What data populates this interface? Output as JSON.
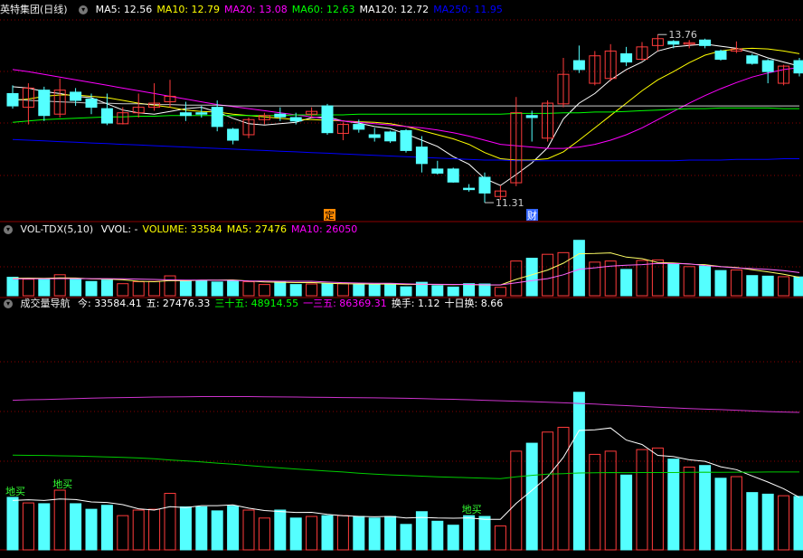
{
  "colors": {
    "up": "#ff3b3b",
    "down": "#54ffff",
    "bg": "#000000",
    "grid": "#8b0000",
    "ma5": "#ffffff",
    "ma10": "#ffff00",
    "ma20": "#ff00ff",
    "ma60": "#00ff00",
    "ma120": "#ffffff",
    "ma250": "#0000ff",
    "vol_ma5": "#ffff66",
    "vol_ma10": "#ff66ff",
    "nav_today": "#ffffff",
    "nav_30": "#00cc00",
    "nav_135": "#cc33cc",
    "marker_ding": "#ff8800",
    "marker_cai": "#3366ff",
    "low_buy": "#33ff33"
  },
  "panel1": {
    "title": "英特集团(日线)",
    "legend": [
      {
        "label": "MA5: 12.56",
        "color": "#ffffff"
      },
      {
        "label": "MA10: 12.79",
        "color": "#ffff00"
      },
      {
        "label": "MA20: 13.08",
        "color": "#ff00ff"
      },
      {
        "label": "MA60: 12.63",
        "color": "#00ff00"
      },
      {
        "label": "MA120: 12.72",
        "color": "#ffffff"
      },
      {
        "label": "MA250: 11.95",
        "color": "#0000ff"
      }
    ],
    "high_label": "13.76",
    "low_label": "11.31",
    "marker_ding": "定",
    "marker_cai": "财"
  },
  "panel2": {
    "title": "VOL-TDX(5,10)",
    "legend": [
      {
        "label": "VVOL: -",
        "color": "#ffffff"
      },
      {
        "label": "VOLUME: 33584",
        "color": "#ffff00"
      },
      {
        "label": "MA5: 27476",
        "color": "#ffff00"
      },
      {
        "label": "MA10: 26050",
        "color": "#ff00ff"
      }
    ]
  },
  "panel3": {
    "title": "成交量导航",
    "legend": [
      {
        "label": "今: 33584.41",
        "color": "#ffffff"
      },
      {
        "label": "五: 27476.33",
        "color": "#ffffff"
      },
      {
        "label": "三十五: 48914.55",
        "color": "#00ff00"
      },
      {
        "label": "一三五: 86369.31",
        "color": "#ff00ff"
      },
      {
        "label": "换手: 1.12",
        "color": "#ffffff"
      },
      {
        "label": "十日换: 8.66",
        "color": "#ffffff"
      }
    ],
    "low_buy_label": "地买"
  },
  "chart_data": {
    "type": "candlestick",
    "title": "英特集团(日线)",
    "candles": [
      {
        "o": 12.9,
        "h": 13.02,
        "l": 12.68,
        "c": 12.72
      },
      {
        "o": 12.7,
        "h": 13.05,
        "l": 12.45,
        "c": 12.98
      },
      {
        "o": 12.95,
        "h": 13.0,
        "l": 12.5,
        "c": 12.58
      },
      {
        "o": 12.6,
        "h": 13.12,
        "l": 12.55,
        "c": 12.95
      },
      {
        "o": 12.92,
        "h": 12.98,
        "l": 12.72,
        "c": 12.8
      },
      {
        "o": 12.82,
        "h": 12.9,
        "l": 12.6,
        "c": 12.7
      },
      {
        "o": 12.68,
        "h": 12.9,
        "l": 12.44,
        "c": 12.47
      },
      {
        "o": 12.46,
        "h": 12.7,
        "l": 12.45,
        "c": 12.62
      },
      {
        "o": 12.62,
        "h": 12.9,
        "l": 12.55,
        "c": 12.7
      },
      {
        "o": 12.7,
        "h": 13.05,
        "l": 12.65,
        "c": 12.76
      },
      {
        "o": 12.78,
        "h": 13.1,
        "l": 12.7,
        "c": 12.86
      },
      {
        "o": 12.62,
        "h": 12.78,
        "l": 12.5,
        "c": 12.58
      },
      {
        "o": 12.62,
        "h": 12.72,
        "l": 12.55,
        "c": 12.6
      },
      {
        "o": 12.7,
        "h": 12.8,
        "l": 12.35,
        "c": 12.42
      },
      {
        "o": 12.38,
        "h": 12.4,
        "l": 12.16,
        "c": 12.22
      },
      {
        "o": 12.3,
        "h": 12.55,
        "l": 12.25,
        "c": 12.52
      },
      {
        "o": 12.52,
        "h": 12.62,
        "l": 12.45,
        "c": 12.58
      },
      {
        "o": 12.6,
        "h": 12.7,
        "l": 12.5,
        "c": 12.56
      },
      {
        "o": 12.55,
        "h": 12.62,
        "l": 12.45,
        "c": 12.5
      },
      {
        "o": 12.6,
        "h": 12.7,
        "l": 12.55,
        "c": 12.64
      },
      {
        "o": 12.72,
        "h": 12.75,
        "l": 12.3,
        "c": 12.33
      },
      {
        "o": 12.32,
        "h": 12.48,
        "l": 12.22,
        "c": 12.45
      },
      {
        "o": 12.45,
        "h": 12.52,
        "l": 12.33,
        "c": 12.38
      },
      {
        "o": 12.3,
        "h": 12.4,
        "l": 12.2,
        "c": 12.26
      },
      {
        "o": 12.34,
        "h": 12.36,
        "l": 12.18,
        "c": 12.21
      },
      {
        "o": 12.36,
        "h": 12.38,
        "l": 12.04,
        "c": 12.07
      },
      {
        "o": 12.12,
        "h": 12.28,
        "l": 11.75,
        "c": 11.88
      },
      {
        "o": 11.8,
        "h": 11.92,
        "l": 11.72,
        "c": 11.74
      },
      {
        "o": 11.8,
        "h": 11.82,
        "l": 11.6,
        "c": 11.61
      },
      {
        "o": 11.52,
        "h": 11.58,
        "l": 11.47,
        "c": 11.5
      },
      {
        "o": 11.68,
        "h": 11.75,
        "l": 11.31,
        "c": 11.45
      },
      {
        "o": 11.4,
        "h": 11.56,
        "l": 11.35,
        "c": 11.48
      },
      {
        "o": 11.6,
        "h": 12.85,
        "l": 11.55,
        "c": 12.62
      },
      {
        "o": 12.58,
        "h": 12.65,
        "l": 12.2,
        "c": 12.55
      },
      {
        "o": 12.25,
        "h": 12.8,
        "l": 12.2,
        "c": 12.76
      },
      {
        "o": 12.75,
        "h": 13.42,
        "l": 12.7,
        "c": 13.18
      },
      {
        "o": 13.38,
        "h": 13.6,
        "l": 13.2,
        "c": 13.25
      },
      {
        "o": 13.05,
        "h": 13.52,
        "l": 13.02,
        "c": 13.45
      },
      {
        "o": 13.12,
        "h": 13.62,
        "l": 13.08,
        "c": 13.52
      },
      {
        "o": 13.48,
        "h": 13.58,
        "l": 13.3,
        "c": 13.36
      },
      {
        "o": 13.4,
        "h": 13.65,
        "l": 13.38,
        "c": 13.58
      },
      {
        "o": 13.6,
        "h": 13.76,
        "l": 13.52,
        "c": 13.7
      },
      {
        "o": 13.66,
        "h": 13.68,
        "l": 13.56,
        "c": 13.62
      },
      {
        "o": 13.62,
        "h": 13.68,
        "l": 13.56,
        "c": 13.64
      },
      {
        "o": 13.68,
        "h": 13.7,
        "l": 13.56,
        "c": 13.6
      },
      {
        "o": 13.52,
        "h": 13.54,
        "l": 13.38,
        "c": 13.4
      },
      {
        "o": 13.52,
        "h": 13.66,
        "l": 13.49,
        "c": 13.55
      },
      {
        "o": 13.45,
        "h": 13.48,
        "l": 13.32,
        "c": 13.34
      },
      {
        "o": 13.38,
        "h": 13.4,
        "l": 13.05,
        "c": 13.22
      },
      {
        "o": 13.05,
        "h": 13.32,
        "l": 13.02,
        "c": 13.3
      },
      {
        "o": 13.38,
        "h": 13.42,
        "l": 13.15,
        "c": 13.2
      }
    ],
    "ma": {
      "MA5": [
        13.0,
        12.98,
        12.93,
        12.9,
        12.86,
        12.84,
        12.75,
        12.66,
        12.62,
        12.6,
        12.64,
        12.68,
        12.7,
        12.63,
        12.54,
        12.46,
        12.44,
        12.46,
        12.48,
        12.55,
        12.56,
        12.5,
        12.47,
        12.42,
        12.39,
        12.31,
        12.22,
        12.13,
        11.98,
        11.87,
        11.66,
        11.56,
        11.72,
        11.89,
        12.11,
        12.53,
        12.76,
        12.9,
        13.1,
        13.25,
        13.36,
        13.52,
        13.58,
        13.6,
        13.62,
        13.59,
        13.56,
        13.5,
        13.42,
        13.36,
        13.3
      ],
      "MA10": [
        12.8,
        12.82,
        12.86,
        12.88,
        12.88,
        12.86,
        12.84,
        12.8,
        12.76,
        12.73,
        12.7,
        12.66,
        12.64,
        12.63,
        12.6,
        12.58,
        12.56,
        12.54,
        12.52,
        12.52,
        12.51,
        12.5,
        12.49,
        12.48,
        12.46,
        12.42,
        12.36,
        12.3,
        12.24,
        12.16,
        12.04,
        11.95,
        11.93,
        11.93,
        11.95,
        12.05,
        12.22,
        12.4,
        12.58,
        12.76,
        12.94,
        13.1,
        13.22,
        13.35,
        13.46,
        13.52,
        13.55,
        13.56,
        13.55,
        13.52,
        13.48
      ],
      "MA20": [
        13.25,
        13.22,
        13.18,
        13.14,
        13.1,
        13.06,
        13.02,
        12.98,
        12.94,
        12.9,
        12.86,
        12.82,
        12.78,
        12.74,
        12.71,
        12.68,
        12.65,
        12.62,
        12.59,
        12.56,
        12.53,
        12.5,
        12.48,
        12.46,
        12.44,
        12.42,
        12.4,
        12.37,
        12.33,
        12.28,
        12.22,
        12.16,
        12.14,
        12.12,
        12.1,
        12.1,
        12.12,
        12.16,
        12.22,
        12.3,
        12.4,
        12.52,
        12.64,
        12.76,
        12.87,
        12.97,
        13.06,
        13.14,
        13.2,
        13.25,
        13.28
      ],
      "MA60": [
        12.48,
        12.5,
        12.52,
        12.53,
        12.54,
        12.55,
        12.56,
        12.56,
        12.57,
        12.57,
        12.58,
        12.58,
        12.58,
        12.58,
        12.58,
        12.58,
        12.58,
        12.58,
        12.59,
        12.59,
        12.59,
        12.59,
        12.6,
        12.6,
        12.6,
        12.6,
        12.6,
        12.6,
        12.6,
        12.6,
        12.6,
        12.6,
        12.61,
        12.61,
        12.61,
        12.62,
        12.62,
        12.63,
        12.63,
        12.64,
        12.65,
        12.66,
        12.67,
        12.68,
        12.68,
        12.69,
        12.69,
        12.69,
        12.69,
        12.68,
        12.68
      ],
      "MA120": [
        12.82,
        12.8,
        12.79,
        12.78,
        12.77,
        12.76,
        12.76,
        12.75,
        12.75,
        12.74,
        12.74,
        12.73,
        12.73,
        12.73,
        12.72,
        12.72,
        12.72,
        12.72,
        12.72,
        12.72,
        12.72,
        12.72,
        12.72,
        12.72,
        12.72,
        12.72,
        12.72,
        12.72,
        12.72,
        12.72,
        12.72,
        12.72,
        12.72,
        12.72,
        12.72,
        12.72,
        12.72,
        12.72,
        12.72,
        12.72,
        12.72,
        12.72,
        12.72,
        12.72,
        12.72,
        12.72,
        12.72,
        12.72,
        12.72,
        12.72,
        12.72
      ],
      "MA250": [
        12.23,
        12.22,
        12.21,
        12.2,
        12.19,
        12.18,
        12.17,
        12.16,
        12.15,
        12.14,
        12.13,
        12.12,
        12.11,
        12.1,
        12.09,
        12.08,
        12.07,
        12.06,
        12.05,
        12.04,
        12.03,
        12.02,
        12.01,
        12.0,
        11.99,
        11.98,
        11.97,
        11.96,
        11.95,
        11.94,
        11.93,
        11.93,
        11.92,
        11.92,
        11.92,
        11.92,
        11.92,
        11.92,
        11.92,
        11.92,
        11.92,
        11.92,
        11.92,
        11.93,
        11.93,
        11.93,
        11.94,
        11.94,
        11.94,
        11.95,
        11.95
      ]
    },
    "volume": [
      33000,
      29500,
      29000,
      37500,
      29000,
      25500,
      28000,
      21500,
      25000,
      25500,
      35500,
      27000,
      27000,
      24500,
      27500,
      25000,
      20000,
      25000,
      20000,
      21000,
      21500,
      21500,
      21000,
      20000,
      21000,
      16000,
      24000,
      18000,
      15500,
      21500,
      21000,
      15000,
      62000,
      67000,
      74000,
      77000,
      99000,
      60000,
      62000,
      47000,
      63000,
      64000,
      57000,
      52000,
      53000,
      45000,
      46000,
      36000,
      35000,
      34000,
      33584
    ],
    "vol_ma5": [
      31000,
      31500,
      31000,
      32000,
      31600,
      30100,
      29800,
      28400,
      25800,
      25000,
      27100,
      26600,
      27800,
      27800,
      28300,
      26200,
      24700,
      24100,
      23500,
      23600,
      22300,
      21500,
      21000,
      20800,
      21000,
      20000,
      20400,
      20000,
      19900,
      20100,
      19200,
      19200,
      29200,
      37400,
      45900,
      58100,
      75000,
      75400,
      76600,
      69000,
      66200,
      59400,
      58600,
      56600,
      55600,
      52200,
      50400,
      46400,
      42600,
      38400,
      33000
    ],
    "vol_ma10": [
      30000,
      30200,
      30300,
      30600,
      30600,
      30500,
      30500,
      30200,
      29700,
      29000,
      28200,
      27900,
      27900,
      27600,
      27500,
      26400,
      26200,
      25900,
      25900,
      25800,
      24400,
      23200,
      22600,
      22200,
      22200,
      21200,
      20600,
      20300,
      20200,
      20300,
      19600,
      19400,
      23000,
      26900,
      30500,
      37400,
      47100,
      49900,
      52900,
      54500,
      55600,
      57800,
      57500,
      56900,
      53900,
      51800,
      49800,
      48500,
      47000,
      44800,
      41400
    ],
    "nav_today": [
      33000,
      29500,
      29000,
      37500,
      29000,
      25500,
      28000,
      21500,
      25000,
      25500,
      35500,
      27000,
      27000,
      24500,
      27500,
      25000,
      20000,
      25000,
      20000,
      21000,
      21500,
      21500,
      21000,
      20000,
      21000,
      16000,
      24000,
      18000,
      15500,
      21500,
      21000,
      15000,
      62000,
      67000,
      74000,
      77000,
      99000,
      60000,
      62000,
      47000,
      63000,
      64000,
      57000,
      52000,
      53000,
      45000,
      46000,
      36000,
      35000,
      34000,
      33584
    ],
    "nav_35": [
      59500,
      59400,
      59300,
      59100,
      58900,
      58700,
      58400,
      58100,
      57700,
      57200,
      56500,
      55900,
      55200,
      54500,
      53800,
      53000,
      52200,
      51500,
      50800,
      50100,
      49500,
      48900,
      48200,
      47600,
      47100,
      46700,
      46300,
      45900,
      45600,
      45300,
      45000,
      44800,
      45900,
      46800,
      47600,
      47900,
      48300,
      48400,
      48600,
      48500,
      48600,
      48600,
      48600,
      48700,
      48800,
      48700,
      48800,
      48800,
      48900,
      48900,
      48914
    ],
    "nav_135": [
      94000,
      94300,
      94500,
      94800,
      95000,
      95300,
      95500,
      95700,
      95800,
      96000,
      96100,
      96200,
      96300,
      96300,
      96300,
      96300,
      96200,
      96100,
      96000,
      95900,
      95800,
      95700,
      95600,
      95500,
      95400,
      95200,
      95000,
      94800,
      94600,
      94300,
      94000,
      93700,
      93400,
      93100,
      92800,
      92400,
      92000,
      91600,
      91100,
      90600,
      90100,
      89600,
      89200,
      88800,
      88400,
      88100,
      87700,
      87300,
      86900,
      86600,
      86369
    ],
    "low_buy_idx": [
      0,
      3,
      29
    ],
    "price_range": [
      11.1,
      14.0
    ],
    "vol_range": [
      0,
      105000
    ],
    "nav_range": [
      0,
      150000
    ]
  }
}
